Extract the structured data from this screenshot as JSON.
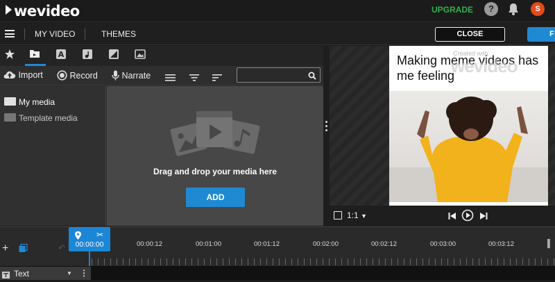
{
  "app": {
    "logo": "wevideo"
  },
  "header": {
    "upgrade_label": "UPGRADE",
    "help_icon": "?",
    "avatar_initial": "S"
  },
  "nav": {
    "project_title": "MY VIDEO",
    "themes_label": "THEMES",
    "close_label": "CLOSE",
    "finish_label": "F"
  },
  "media": {
    "tabs": [
      "favorites-icon",
      "media-folder-icon",
      "text-icon",
      "audio-icon",
      "transition-icon",
      "image-icon"
    ],
    "toolbar": {
      "import_label": "Import",
      "record_label": "Record",
      "narrate_label": "Narrate",
      "search_placeholder": ""
    },
    "sidebar": [
      {
        "label": "My media"
      },
      {
        "label": "Template media"
      }
    ],
    "drop_text": "Drag and drop your media here",
    "add_label": "ADD"
  },
  "preview": {
    "caption": "Making meme videos has me feeling",
    "watermark_text": "Created with",
    "watermark_logo": "wevideo",
    "ratio_label": "1:1"
  },
  "timeline": {
    "playhead_time": "00:00:00",
    "ticks": [
      "00:00:12",
      "00:01:00",
      "00:01:12",
      "00:02:00",
      "00:02:12",
      "00:03:00",
      "00:03:12"
    ],
    "track_label": "Text"
  },
  "colors": {
    "accent": "#1f8ad2",
    "upgrade": "#2fb24c",
    "avatar": "#e64a19"
  }
}
